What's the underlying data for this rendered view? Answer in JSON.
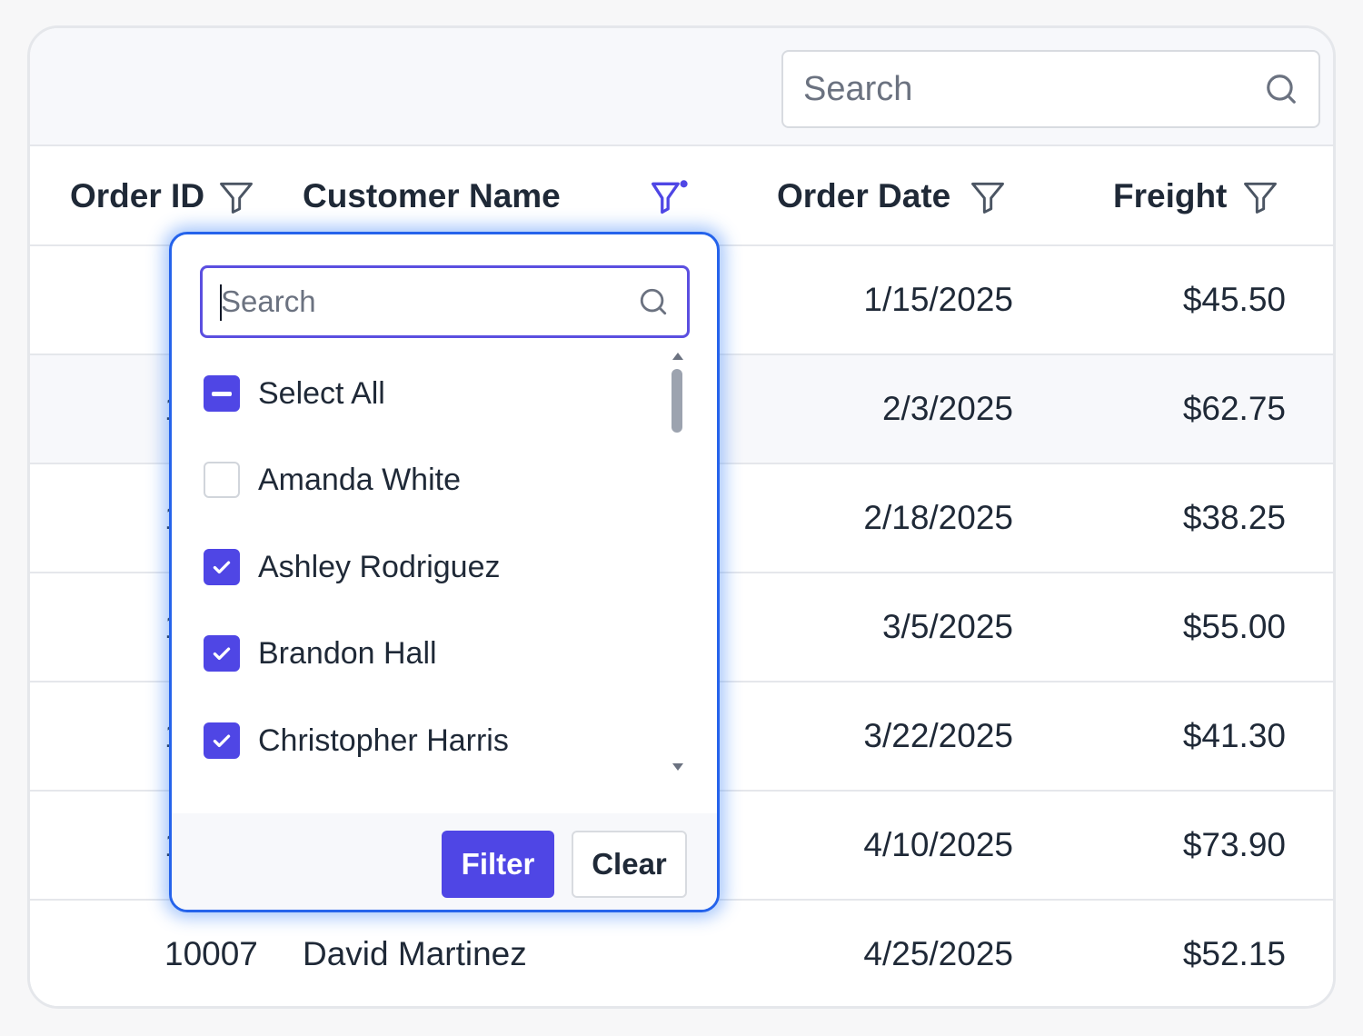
{
  "toolbar": {
    "search_placeholder": "Search"
  },
  "columns": {
    "order_id": "Order ID",
    "customer_name": "Customer Name",
    "order_date": "Order Date",
    "freight": "Freight"
  },
  "rows": [
    {
      "order_id": "",
      "customer": "",
      "date": "1/15/2025",
      "freight": "$45.50"
    },
    {
      "order_id": "1",
      "customer": "",
      "date": "2/3/2025",
      "freight": "$62.75"
    },
    {
      "order_id": "1",
      "customer": "",
      "date": "2/18/2025",
      "freight": "$38.25"
    },
    {
      "order_id": "1",
      "customer": "",
      "date": "3/5/2025",
      "freight": "$55.00"
    },
    {
      "order_id": "1",
      "customer": "",
      "date": "3/22/2025",
      "freight": "$41.30"
    },
    {
      "order_id": "1",
      "customer": "",
      "date": "4/10/2025",
      "freight": "$73.90"
    },
    {
      "order_id": "10007",
      "customer": "David Martinez",
      "date": "4/25/2025",
      "freight": "$52.15"
    }
  ],
  "filter_popup": {
    "search_placeholder": "Search",
    "options": [
      {
        "label": "Select All",
        "state": "indeterminate"
      },
      {
        "label": "Amanda White",
        "state": "unchecked"
      },
      {
        "label": "Ashley Rodriguez",
        "state": "checked"
      },
      {
        "label": "Brandon Hall",
        "state": "checked"
      },
      {
        "label": "Christopher Harris",
        "state": "checked"
      }
    ],
    "filter_label": "Filter",
    "clear_label": "Clear"
  },
  "colors": {
    "accent": "#4f46e5",
    "popup_border": "#2563eb",
    "active_filter_icon": "#4f46e5"
  },
  "icons": {
    "toolbar_search": "search-icon",
    "column_filter": "funnel-icon",
    "active_column_filter": "funnel-active-icon",
    "popup_search": "search-icon",
    "checked": "checkmark-icon"
  }
}
